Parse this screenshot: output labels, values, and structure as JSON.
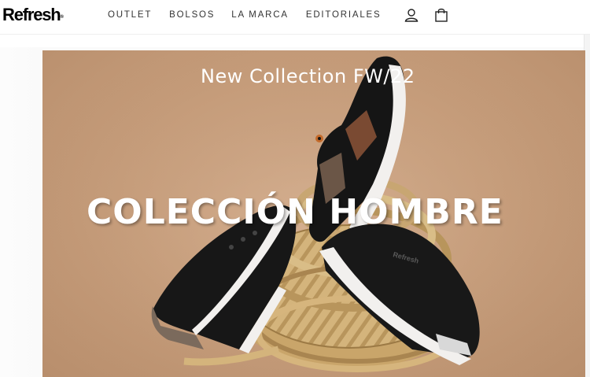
{
  "header": {
    "logo": "Refresh",
    "logo_mark": "®",
    "nav": [
      "OUTLET",
      "BOLSOS",
      "LA MARCA",
      "EDITORIALES"
    ],
    "icons": {
      "account": "user-icon",
      "cart": "shopping-bag-icon"
    }
  },
  "hero": {
    "subtitle": "New Collection FW/22",
    "title": "COLECCIÓN HOMBRE",
    "shoe_brand": "Refresh"
  },
  "colors": {
    "hero_background": "#c9a07f",
    "rope": "#d4b47c",
    "shoe_black": "#161616",
    "shoe_brown": "#7a4a32",
    "sole": "#f2f0ee",
    "text_on_hero": "#ffffff"
  }
}
